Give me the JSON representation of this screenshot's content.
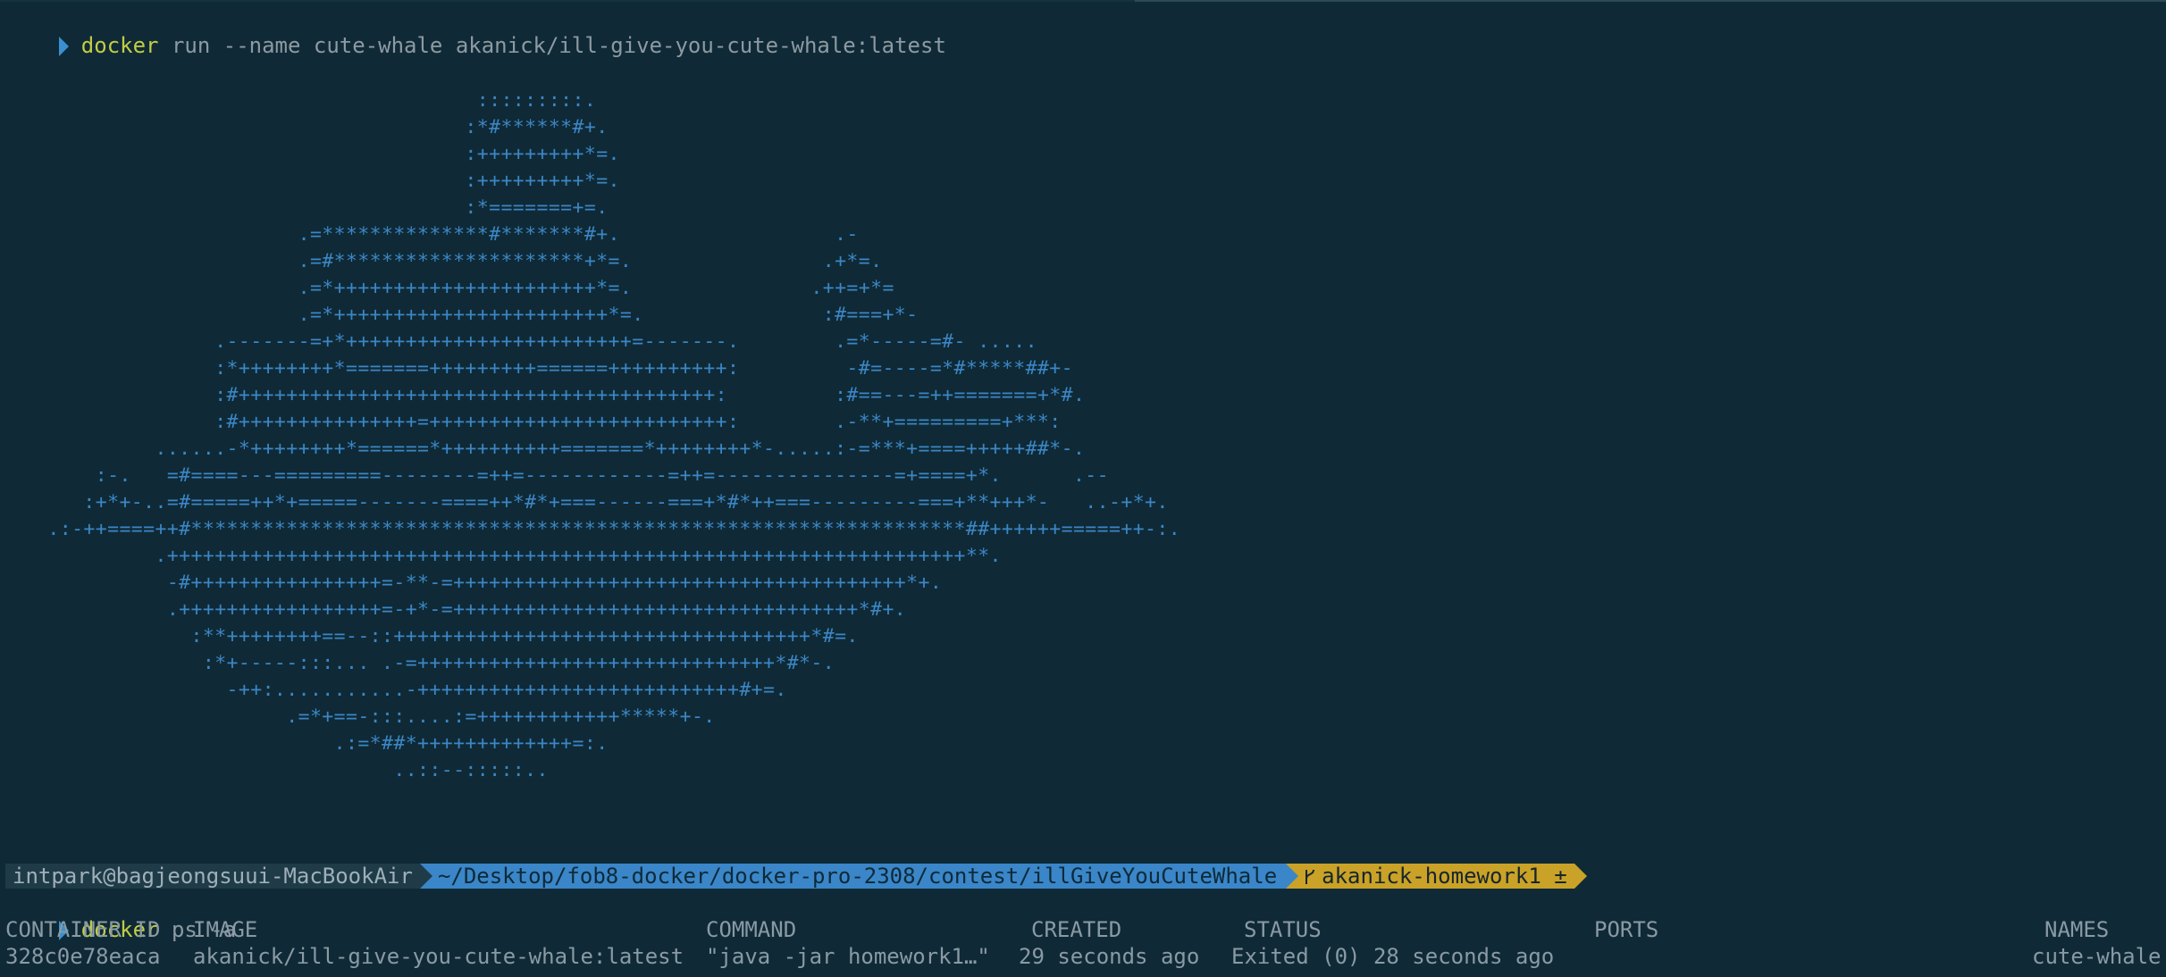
{
  "terminal": {
    "command1": {
      "word": "docker",
      "args": " run --name cute-whale akanick/ill-give-you-cute-whale:latest"
    },
    "ascii_art": [
      "                                        :::::::::.",
      "                                       :*#******#+.",
      "                                       :+++++++++*=.",
      "                                       :+++++++++*=.",
      "                                       :*=======+=.",
      "                         .=**************#*******#+.                  .-",
      "                         .=#*********************+*=.                .+*=.",
      "                         .=*++++++++++++++++++++++*=.               .++=+*=",
      "                         .=*+++++++++++++++++++++++*=.               :#===+*-",
      "                  .-------=+*++++++++++++++++++++++++=-------.        .=*-----=#- .....",
      "                  :*++++++++*=======+++++++++======++++++++++:         -#=----=*#*****##+-",
      "                  :#++++++++++++++++++++++++++++++++++++++++:         :#==---=++=======+*#.",
      "                  :#+++++++++++++++=+++++++++++++++++++++++++:        .-**+=========+***:",
      "             ......-*++++++++*======*++++++++++=======*++++++++*-.....:-=***+====+++++##*-.",
      "        :-.   =#====---=========--------=++=------------=++=---------------=+====+*.      .--",
      "       :+*+-..=#=====++*+=====-------====++*#*+===------===+*#*++===---------===+**+++*-   ..-+*+.",
      "    .:-++====++#*****************************************************************##++++++=====++-:.",
      "             .+++++++++++++++++++++++++++++++++++++++++++++++++++++++++++++++++++**.",
      "              -#++++++++++++++++=-**-=++++++++++++++++++++++++++++++++++++++*+.",
      "              .+++++++++++++++++=-+*-=++++++++++++++++++++++++++++++++++*#+.",
      "                :**++++++++==--::+++++++++++++++++++++++++++++++++++*#=.",
      "                 :*+-----:::... .-=++++++++++++++++++++++++++++++*#*-.",
      "                   -++:...........-+++++++++++++++++++++++++++#+=.",
      "                        .=*+==-:::....:=++++++++++++*****+-.",
      "                            .:=*##*+++++++++++++=:.",
      "                                 ..::--:::::.."
    ],
    "prompt": {
      "user_host": "intpark@bagjeongsuui-MacBookAir",
      "path": "~/Desktop/fob8-docker/docker-pro-2308/contest/illGiveYouCuteWhale",
      "git_branch": "akanick-homework1",
      "git_icon": "branch-icon",
      "git_status": "±"
    },
    "command2": {
      "word": "docker",
      "args": " ps -a"
    },
    "ps_table": {
      "headers": {
        "container_id": "CONTAINER ID",
        "image": "IMAGE",
        "command": "COMMAND",
        "created": "CREATED",
        "status": "STATUS",
        "ports": "PORTS",
        "names": "NAMES"
      },
      "rows": [
        {
          "container_id": "328c0e78eaca",
          "image": "akanick/ill-give-you-cute-whale:latest",
          "command": "\"java -jar homework1…\"",
          "created": "29 seconds ago",
          "status": "Exited (0) 28 seconds ago",
          "ports": "",
          "names": "cute-whale"
        }
      ]
    }
  },
  "colors": {
    "background": "#0f2a36",
    "ascii_art": "#3c86c6",
    "command_word": "#c2cd44",
    "prompt_user_bg": "#1f3b48",
    "prompt_path_bg": "#3a86c8",
    "prompt_git_bg": "#c9a227"
  }
}
